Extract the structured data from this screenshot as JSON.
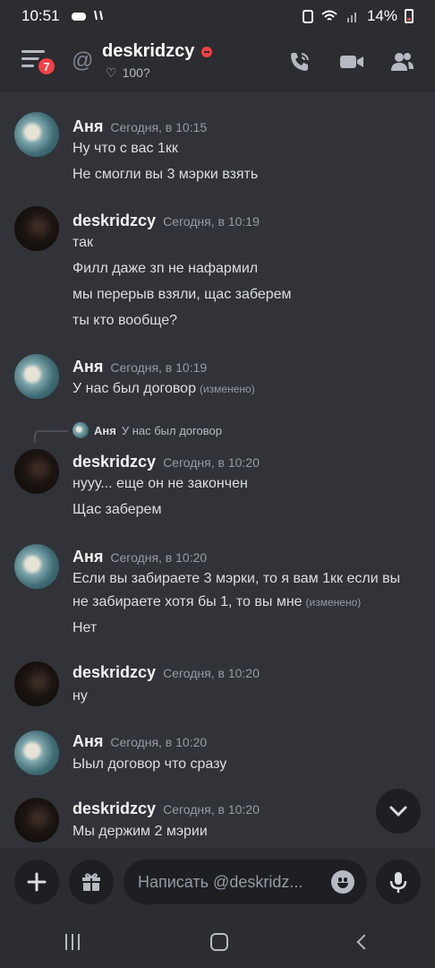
{
  "status_bar": {
    "time": "10:51",
    "battery": "14%"
  },
  "header": {
    "unread_badge": "7",
    "channel_name": "deskridzcy",
    "status_text": "100?",
    "icons": [
      "menu-icon",
      "at-icon",
      "call-icon",
      "video-icon",
      "members-icon"
    ]
  },
  "messages": [
    {
      "author": "Аня",
      "time": "Сегодня, в 10:15",
      "lines": [
        "Ну что с вас 1кк",
        "Не смогли вы 3 мэрки взять"
      ]
    },
    {
      "author": "deskridzcy",
      "time": "Сегодня, в 10:19",
      "lines": [
        "так",
        "Филл даже зп не нафармил",
        "мы перерыв взяли, щас заберем",
        "ты кто вообще?"
      ]
    },
    {
      "author": "Аня",
      "time": "Сегодня, в 10:19",
      "lines": [
        "У нас был договор"
      ],
      "edited": "(изменено)"
    },
    {
      "reply": {
        "name": "Аня",
        "text": "У нас был договор"
      },
      "author": "deskridzcy",
      "time": "Сегодня, в 10:20",
      "lines": [
        "нууу... еще он не закончен",
        "Щас заберем"
      ]
    },
    {
      "author": "Аня",
      "time": "Сегодня, в 10:20",
      "lines": [
        "Если вы забираете 3 мэрки, то я вам 1кк если вы",
        "не забираете хотя бы 1, то вы мне",
        "Нет"
      ],
      "edited": "(изменено)"
    },
    {
      "author": "deskridzcy",
      "time": "Сегодня, в 10:20",
      "lines": [
        "ну"
      ]
    },
    {
      "author": "Аня",
      "time": "Сегодня, в 10:20",
      "lines": [
        "Ыыл договор что сразу"
      ]
    },
    {
      "author": "deskridzcy",
      "time": "Сегодня, в 10:20",
      "lines": [
        "Мы держим 2 мэрии"
      ]
    }
  ],
  "composer": {
    "placeholder": "Написать @deskridz..."
  },
  "colors": {
    "background": "#313338",
    "header": "#2b2d31",
    "dnd": "#f23f43",
    "badge": "#f23f43"
  }
}
